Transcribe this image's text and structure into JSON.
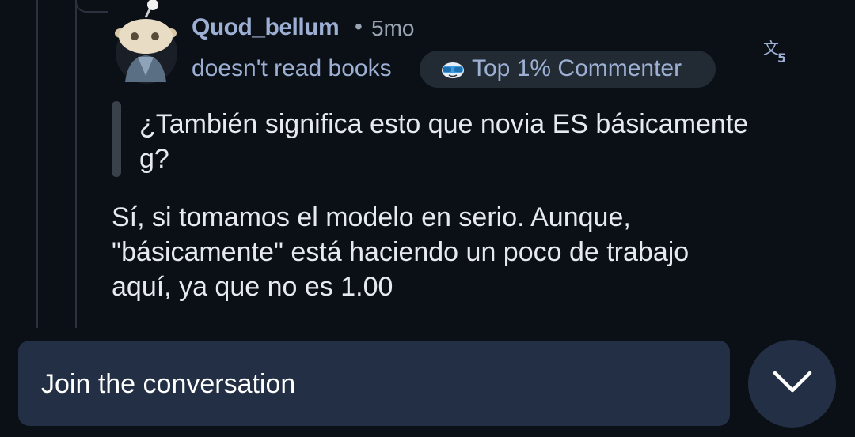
{
  "comment": {
    "username": "Quod_bellum",
    "separator": "•",
    "timestamp": "5mo",
    "user_flair": "doesn't read books",
    "badge": {
      "icon": "sunglasses-emoji-icon",
      "label": "Top 1% Commenter"
    },
    "translate_icon": "translate-icon",
    "quote": "¿También significa esto que novia ES básicamente g?",
    "body": [
      "Sí, si tomamos el modelo en serio. Aunque,",
      "\"básicamente\" está haciendo un poco de trabajo",
      "aquí, ya que no es 1.00"
    ]
  },
  "composer": {
    "placeholder": "Join the conversation"
  },
  "collapse_button": {
    "icon": "chevron-down-icon"
  },
  "colors": {
    "background": "#0b1017",
    "username": "#9db0d3",
    "meta": "#9aa4b2",
    "body_text": "#e6e9ee",
    "badge_bg": "#222a34",
    "composer_bg": "#232f44"
  }
}
